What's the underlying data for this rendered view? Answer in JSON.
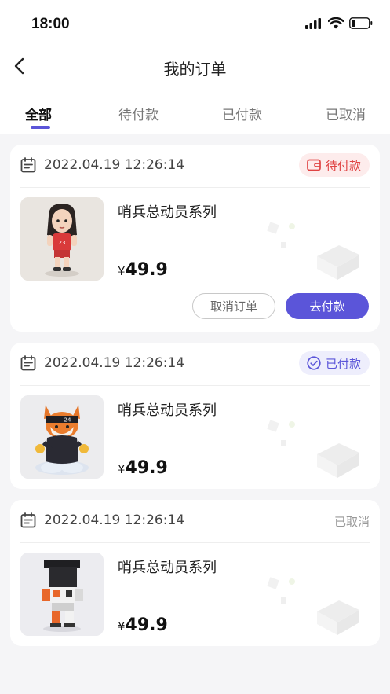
{
  "status_bar": {
    "time": "18:00"
  },
  "nav": {
    "title": "我的订单"
  },
  "tabs": [
    {
      "label": "全部",
      "active": true
    },
    {
      "label": "待付款",
      "active": false
    },
    {
      "label": "已付款",
      "active": false
    },
    {
      "label": "已取消",
      "active": false
    }
  ],
  "orders": [
    {
      "datetime": "2022.04.19 12:26:14",
      "status": "待付款",
      "status_icon": "wallet-icon",
      "product_name": "哨兵总动员系列",
      "currency": "¥",
      "price": "49.9",
      "actions": {
        "cancel_label": "取消订单",
        "pay_label": "去付款"
      }
    },
    {
      "datetime": "2022.04.19 12:26:14",
      "status": "已付款",
      "status_icon": "check-circle-icon",
      "product_name": "哨兵总动员系列",
      "currency": "¥",
      "price": "49.9"
    },
    {
      "datetime": "2022.04.19 12:26:14",
      "status": "已取消",
      "product_name": "哨兵总动员系列",
      "currency": "¥",
      "price": "49.9"
    }
  ],
  "colors": {
    "accent": "#5b55d9",
    "pending": "#e04343",
    "pending_bg": "#fdecec",
    "paid_bg": "#eeeefc"
  }
}
